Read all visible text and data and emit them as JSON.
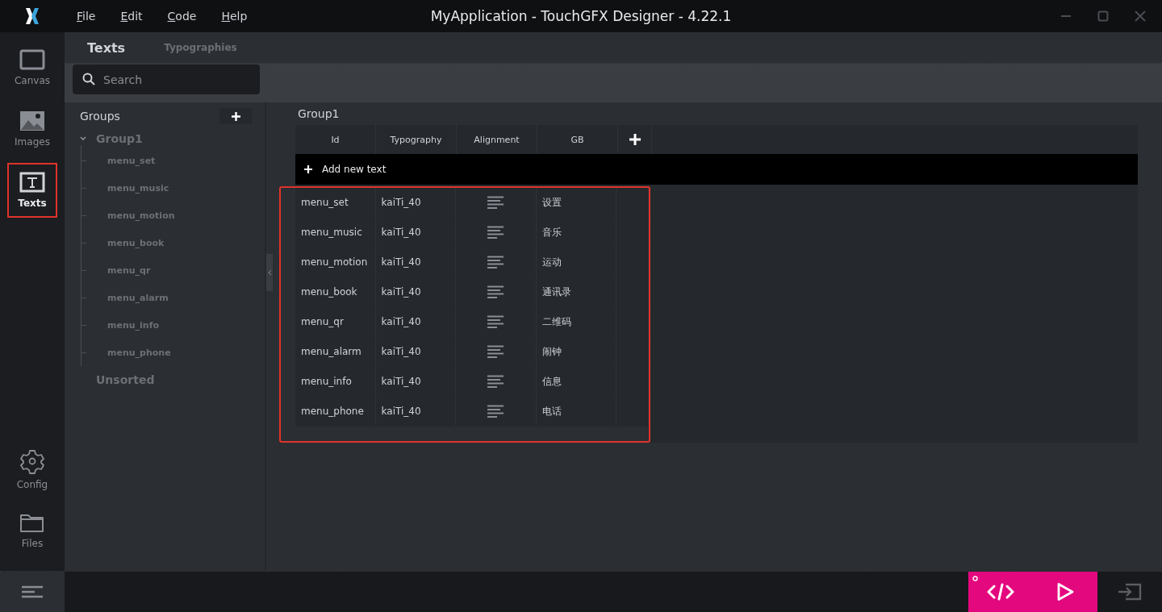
{
  "window": {
    "title": "MyApplication - TouchGFX Designer - 4.22.1"
  },
  "menu": [
    "File",
    "Edit",
    "Code",
    "Help"
  ],
  "nav": [
    {
      "label": "Canvas",
      "selected": false,
      "highlighted": false
    },
    {
      "label": "Images",
      "selected": false,
      "highlighted": false
    },
    {
      "label": "Texts",
      "selected": true,
      "highlighted": true
    },
    {
      "label": "Config",
      "selected": false,
      "highlighted": false
    },
    {
      "label": "Files",
      "selected": false,
      "highlighted": false
    }
  ],
  "tabs": [
    {
      "label": "Texts",
      "selected": true
    },
    {
      "label": "Typographies",
      "selected": false
    }
  ],
  "search": {
    "placeholder": "Search"
  },
  "groups": {
    "title": "Groups",
    "tree": [
      {
        "label": "Group1",
        "expanded": true,
        "children": [
          {
            "label": "menu_set"
          },
          {
            "label": "menu_music"
          },
          {
            "label": "menu_motion"
          },
          {
            "label": "menu_book"
          },
          {
            "label": "menu_qr"
          },
          {
            "label": "menu_alarm"
          },
          {
            "label": "menu_info"
          },
          {
            "label": "menu_phone"
          }
        ]
      },
      {
        "label": "Unsorted",
        "expanded": false
      }
    ]
  },
  "table": {
    "title": "Group1",
    "columns": [
      "Id",
      "Typography",
      "Alignment",
      "GB"
    ],
    "add_text": "Add new text",
    "rows_highlighted": true,
    "rows": [
      {
        "id": "menu_set",
        "typography": "kaiTi_40",
        "gb": "设置"
      },
      {
        "id": "menu_music",
        "typography": "kaiTi_40",
        "gb": "音乐"
      },
      {
        "id": "menu_motion",
        "typography": "kaiTi_40",
        "gb": "运动"
      },
      {
        "id": "menu_book",
        "typography": "kaiTi_40",
        "gb": "通讯录"
      },
      {
        "id": "menu_qr",
        "typography": "kaiTi_40",
        "gb": "二维码"
      },
      {
        "id": "menu_alarm",
        "typography": "kaiTi_40",
        "gb": "闹钟"
      },
      {
        "id": "menu_info",
        "typography": "kaiTi_40",
        "gb": "信息"
      },
      {
        "id": "menu_phone",
        "typography": "kaiTi_40",
        "gb": "电话"
      }
    ]
  }
}
